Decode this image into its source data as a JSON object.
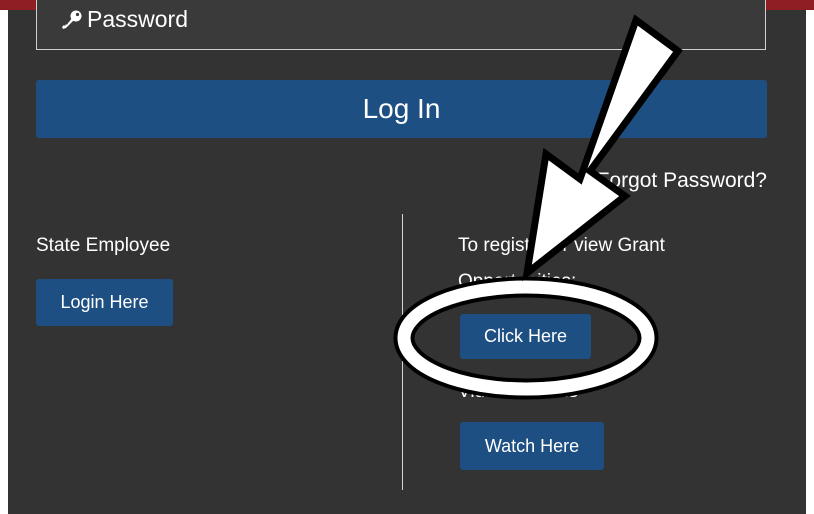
{
  "password": {
    "placeholder": "Password"
  },
  "login": {
    "label": "Log In"
  },
  "forgot": {
    "label": "Forgot Password?"
  },
  "state_employee": {
    "label": "State Employee",
    "button": "Login Here"
  },
  "register": {
    "line1": "To register or view Grant",
    "line2": "Opportunities:",
    "button": "Click Here"
  },
  "video": {
    "line": "Video tutorials",
    "button": "Watch Here"
  },
  "colors": {
    "header_red": "#8e1e24",
    "panel_bg": "#333333",
    "button_blue": "#1d4f82",
    "annotation": "#ffffff",
    "annotation_outline": "#000000"
  },
  "icons": {
    "password": "key-icon",
    "annotation_arrow": "arrow-icon",
    "annotation_circle": "circle-highlight"
  }
}
